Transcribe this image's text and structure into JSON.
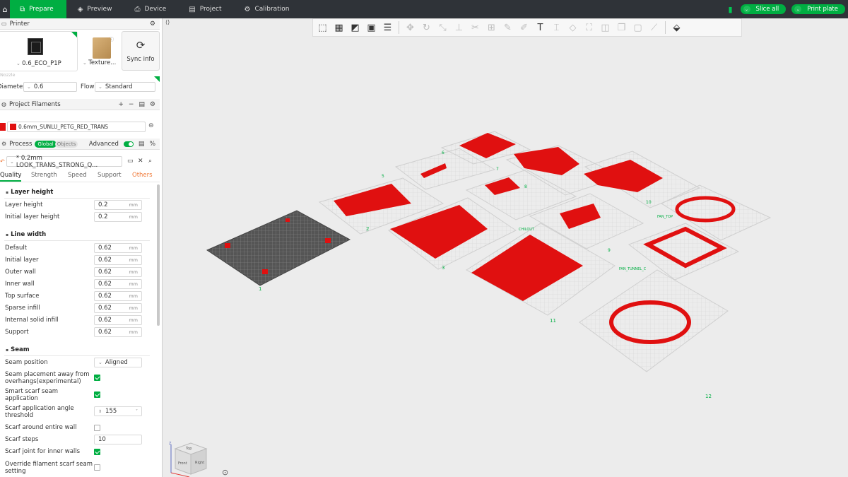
{
  "topbar": {
    "tabs": [
      {
        "label": "Prepare",
        "icon": "cube-stack-icon"
      },
      {
        "label": "Preview",
        "icon": "layers-icon"
      },
      {
        "label": "Device",
        "icon": "printer-icon"
      },
      {
        "label": "Project",
        "icon": "document-icon"
      },
      {
        "label": "Calibration",
        "icon": "calibration-icon"
      }
    ],
    "slice_all": "Slice all",
    "print_plate": "Print plate"
  },
  "printer": {
    "section_title": "Printer",
    "printer_name": "0.6_ECO_P1P",
    "plate_name": "Texture...",
    "sync_label": "Sync info",
    "nozzle_label": "Nozzle",
    "diameter_label": "Diameter",
    "diameter_value": "0.6",
    "flow_label": "Flow",
    "flow_value": "Standard"
  },
  "filaments": {
    "section_title": "Project Filaments",
    "items": [
      {
        "index": "1",
        "name": "0.6mm_SUNLU_PETG_RED_TRANS",
        "color": "#e01010"
      }
    ]
  },
  "process": {
    "section_title": "Process",
    "global_pill": "Global",
    "objects_pill": "Objects",
    "advanced_label": "Advanced",
    "preset": "* 0.2mm LOOK_TRANS_STRONG_Q...",
    "tabs": [
      "Quality",
      "Strength",
      "Speed",
      "Support",
      "Others"
    ]
  },
  "quality": {
    "layer_height_title": "Layer height",
    "layer_height_rows": [
      {
        "label": "Layer height",
        "value": "0.2",
        "unit": "mm"
      },
      {
        "label": "Initial layer height",
        "value": "0.2",
        "unit": "mm"
      }
    ],
    "line_width_title": "Line width",
    "line_width_rows": [
      {
        "label": "Default",
        "value": "0.62",
        "unit": "mm"
      },
      {
        "label": "Initial layer",
        "value": "0.62",
        "unit": "mm"
      },
      {
        "label": "Outer wall",
        "value": "0.62",
        "unit": "mm"
      },
      {
        "label": "Inner wall",
        "value": "0.62",
        "unit": "mm"
      },
      {
        "label": "Top surface",
        "value": "0.62",
        "unit": "mm"
      },
      {
        "label": "Sparse infill",
        "value": "0.62",
        "unit": "mm"
      },
      {
        "label": "Internal solid infill",
        "value": "0.62",
        "unit": "mm"
      },
      {
        "label": "Support",
        "value": "0.62",
        "unit": "mm"
      }
    ],
    "seam_title": "Seam",
    "seam_position_label": "Seam position",
    "seam_position_value": "Aligned",
    "seam_overhang_label_1": "Seam placement away from",
    "seam_overhang_label_2": "overhangs(experimental)",
    "seam_overhang_checked": true,
    "smart_scarf_label_1": "Smart scarf seam",
    "smart_scarf_label_2": "application",
    "smart_scarf_checked": true,
    "scarf_angle_label_1": "Scarf application angle",
    "scarf_angle_label_2": "threshold",
    "scarf_angle_value": "155",
    "scarf_entire_label": "Scarf around entire wall",
    "scarf_entire_checked": false,
    "scarf_steps_label": "Scarf steps",
    "scarf_steps_value": "10",
    "scarf_inner_label": "Scarf joint for inner walls",
    "scarf_inner_checked": true,
    "override_label_1": "Override filament scarf seam",
    "override_label_2": "setting",
    "override_checked": false
  },
  "plates": [
    {
      "number": "1",
      "name": ""
    },
    {
      "number": "2",
      "name": ""
    },
    {
      "number": "3",
      "name": ""
    },
    {
      "number": "5",
      "name": ""
    },
    {
      "number": "6",
      "name": ""
    },
    {
      "number": "7",
      "name": ""
    },
    {
      "number": "8",
      "name": ""
    },
    {
      "number": "9",
      "name": ""
    },
    {
      "number": "10",
      "name": "FAN_TOP"
    },
    {
      "number": "11",
      "name": "CHILOUT"
    },
    {
      "number": "12",
      "name": "FAN_TUNNEL_C"
    }
  ],
  "navcube": {
    "top": "Top",
    "front": "Front",
    "right": "Right",
    "axis_z": "Z"
  },
  "colors": {
    "accent": "#00ae42",
    "part": "#e01010",
    "topbar": "#2f3338"
  }
}
